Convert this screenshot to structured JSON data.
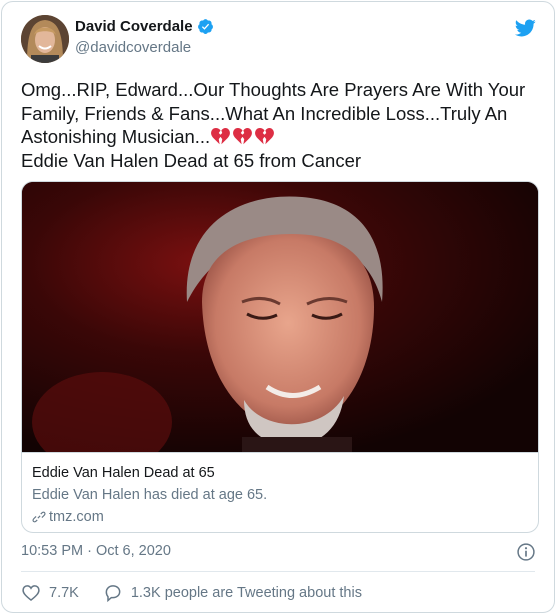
{
  "author": {
    "display_name": "David Coverdale",
    "handle": "@davidcoverdale",
    "verified": true
  },
  "tweet": {
    "text_line1": "Omg...RIP, Edward...Our Thoughts Are Prayers Are With Your Family, Friends & Fans...What An Incredible Loss...Truly An Astonishing Musician...",
    "emojis": [
      "broken-heart",
      "broken-heart",
      "broken-heart"
    ],
    "text_line2": "Eddie Van Halen Dead at 65 from Cancer"
  },
  "link_card": {
    "title": "Eddie Van Halen Dead at 65",
    "description": "Eddie Van Halen has died at age 65.",
    "domain": "tmz.com"
  },
  "timestamp": "10:53 PM · Oct 6, 2020",
  "actions": {
    "likes": "7.7K",
    "conversation": "1.3K people are Tweeting about this"
  },
  "colors": {
    "twitter_blue": "#1da1f2",
    "secondary_text": "#657786",
    "border": "#cfd9de",
    "heart_red": "#e0245e"
  },
  "icons": [
    "verified-badge-icon",
    "twitter-bird-icon",
    "broken-heart-icon",
    "link-icon",
    "info-icon",
    "heart-outline-icon",
    "comment-bubble-icon"
  ]
}
